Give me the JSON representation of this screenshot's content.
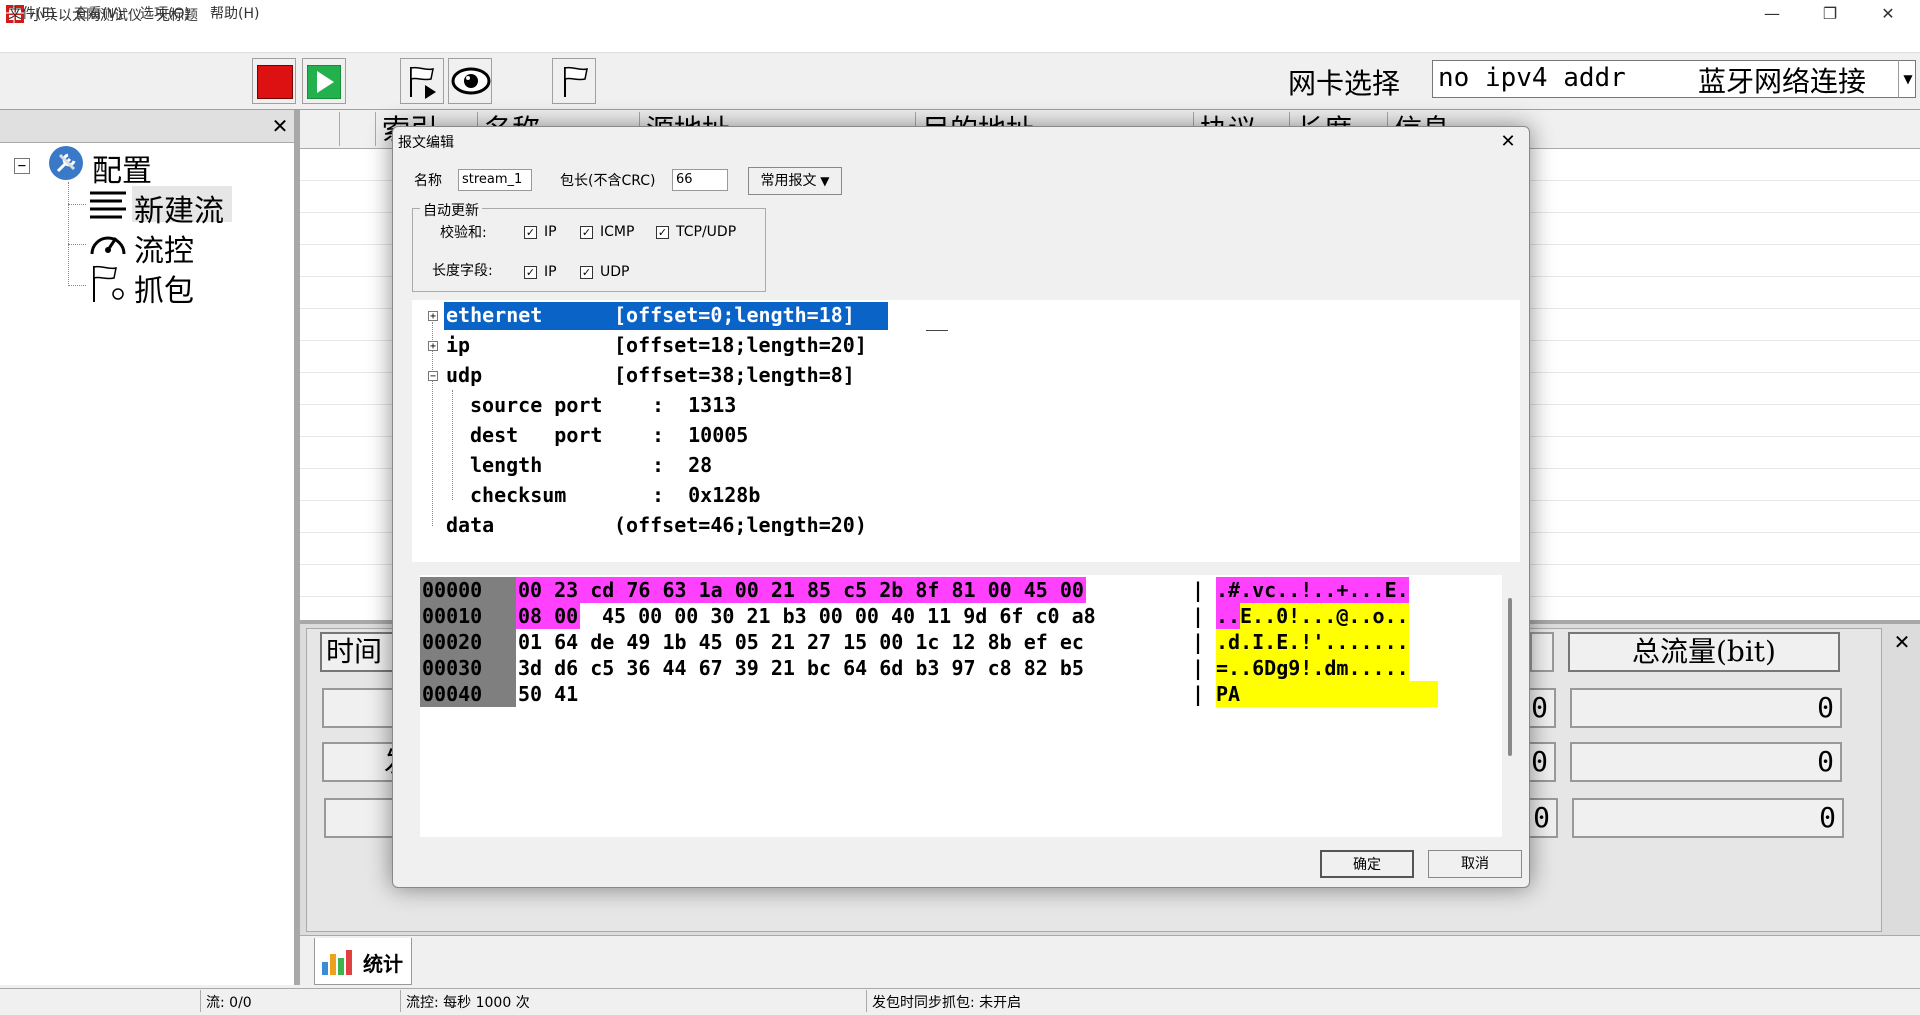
{
  "window": {
    "title": "小兵以太网测试仪 - 无标题",
    "minimize": "—",
    "restore": "❐",
    "close": "✕"
  },
  "menu": [
    "文件(F)",
    "查看(V)",
    "选项(O)",
    "帮助(H)"
  ],
  "toolbar": {
    "nic_label": "网卡选择",
    "nic_value": "no ipv4 addr",
    "nic_name": "蓝牙网络连接",
    "nic_arrow": "▼"
  },
  "tree": {
    "close": "✕",
    "root": "配置",
    "collapse_sign": "−",
    "items": [
      "新建流",
      "流控",
      "抓包"
    ]
  },
  "list": {
    "columns": [
      "",
      "索引",
      "名称",
      "源地址",
      "目的地址",
      "协议",
      "长度",
      "信息"
    ]
  },
  "stats": {
    "close": "✕",
    "time_header": "时间",
    "row_label": "发",
    "total_header": "总流量(bit)",
    "left_values": [
      "0",
      "0",
      "0"
    ],
    "total_values": [
      "0",
      "0",
      "0"
    ],
    "tab_label": "统计"
  },
  "statusbar": {
    "flows": "流: 0/0",
    "flow_control": "流控: 每秒 1000 次",
    "capture": "发包时同步抓包: 未开启"
  },
  "dialog": {
    "title": "报文编辑",
    "close": "✕",
    "name_label": "名称",
    "name_value": "stream_1",
    "len_label": "包长(不含CRC)",
    "len_value": "66",
    "common_btn": "常用报文",
    "group_title": "自动更新",
    "checksum_label": "校验和:",
    "checksum_opts": [
      "IP",
      "ICMP",
      "TCP/UDP"
    ],
    "lenfield_label": "长度字段:",
    "lenfield_opts": [
      "IP",
      "UDP"
    ],
    "check_mark": "✓",
    "ok": "确定",
    "cancel": "取消",
    "tree": [
      {
        "name": "ethernet",
        "info": "[offset=0;length=18]",
        "sign": "+"
      },
      {
        "name": "ip",
        "info": "[offset=18;length=20]",
        "sign": "+"
      },
      {
        "name": "udp",
        "info": "[offset=38;length=8]",
        "sign": "−"
      },
      {
        "name": "source port",
        "info": ":  1313"
      },
      {
        "name": "dest   port",
        "info": ":  10005"
      },
      {
        "name": "length",
        "info": ":  28"
      },
      {
        "name": "checksum",
        "info": ":  0x128b"
      },
      {
        "name": "data",
        "info": "(offset=46;length=20)"
      }
    ],
    "hex": {
      "separator": "|",
      "rows": [
        {
          "offset": "00000",
          "hl": "00 23 cd 76 63 1a 00 21 85 c5 2b 8f 81 00 45 00",
          "plain": "",
          "ascii_hl": ".#.vc..!..+...E.",
          "ascii_plain": ""
        },
        {
          "offset": "00010",
          "hl": "08 00",
          "plain": "45 00 00 30 21 b3 00 00 40 11 9d 6f c0 a8",
          "ascii_hl": "..",
          "ascii_plain": "E..0!...@..o.."
        },
        {
          "offset": "00020",
          "hl": "",
          "plain": "01 64 de 49 1b 45 05 21 27 15 00 1c 12 8b ef ec",
          "ascii_hl": "",
          "ascii_plain": ".d.I.E.!'......."
        },
        {
          "offset": "00030",
          "hl": "",
          "plain": "3d d6 c5 36 44 67 39 21 bc 64 6d b3 97 c8 82 b5",
          "ascii_hl": "",
          "ascii_plain": "=..6Dg9!.dm....."
        },
        {
          "offset": "00040",
          "hl": "",
          "plain": "50 41",
          "ascii_hl": "",
          "ascii_plain": "PA"
        }
      ]
    }
  },
  "colors": {
    "highlight_magenta": "#ff40ff",
    "highlight_yellow": "#ffff00",
    "selection_blue": "#0a64c8",
    "offset_gray": "#7f7f7f"
  }
}
